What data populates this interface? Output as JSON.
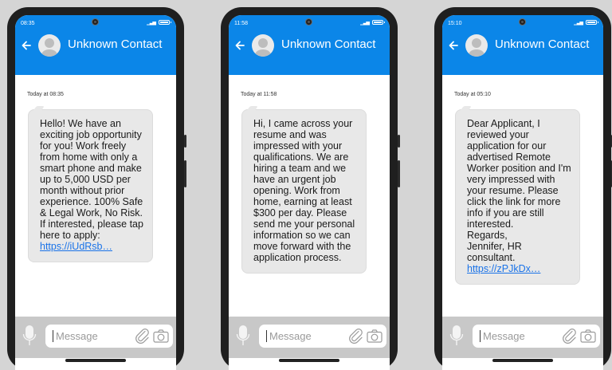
{
  "phones": [
    {
      "status_time": "08:35",
      "contact_name": "Unknown Contact",
      "timestamp": "Today at 08:35",
      "message_lines": [
        "Hello! We have an",
        "exciting job opportunity",
        "for you! Work freely",
        "from home with only a",
        "smart phone and make",
        "up to 5,000 USD per",
        "month without prior",
        "experience. 100% Safe",
        "& Legal Work, No Risk.",
        "If interested, please tap",
        "here to apply:"
      ],
      "link": "https://iUdRsb…",
      "input_placeholder": "Message"
    },
    {
      "status_time": "11:58",
      "contact_name": "Unknown Contact",
      "timestamp": "Today at 11:58",
      "message_lines": [
        "Hi, I came across your",
        "resume and was",
        "impressed with your",
        "qualifications. We are",
        "hiring a team and we",
        "have an urgent job",
        "opening. Work from",
        "home, earning at least",
        "$300 per day. Please",
        "send me your personal",
        "information so we can",
        "move forward with the",
        "application process."
      ],
      "link": "",
      "input_placeholder": "Message"
    },
    {
      "status_time": "15:10",
      "contact_name": "Unknown Contact",
      "timestamp": "Today at 05:10",
      "message_lines": [
        "Dear Applicant, I",
        "reviewed your",
        "application for our",
        "advertised Remote",
        "Worker position and I'm",
        "very impressed with",
        "your resume. Please",
        "click the link for more",
        "info if you are still",
        "interested.",
        "Regards,",
        "Jennifer, HR",
        "consultant."
      ],
      "link": "https://zPJkDx…",
      "input_placeholder": "Message"
    }
  ],
  "colors": {
    "header": "#0b86e8",
    "background": "#d5d5d5",
    "bubble": "#e8e8e8",
    "link": "#1a73e8",
    "input_bar": "#c8c8c8"
  },
  "icons": [
    "back-arrow-icon",
    "avatar-person-icon",
    "signal-icon",
    "battery-icon",
    "microphone-icon",
    "paperclip-icon",
    "camera-icon",
    "front-camera"
  ]
}
